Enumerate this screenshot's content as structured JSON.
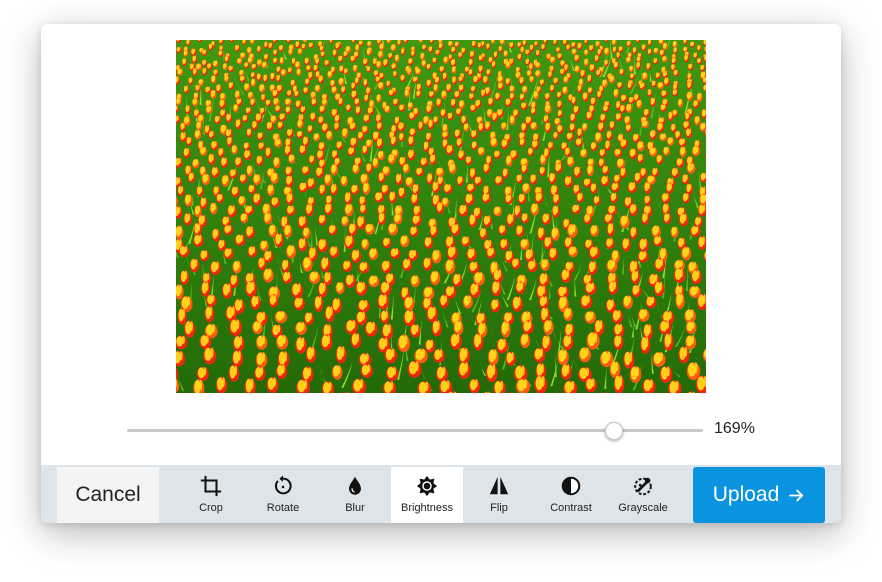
{
  "image": {
    "subject": "tulip-field-photo",
    "colors": {
      "background": "#2f7e0b",
      "petal_red": "#f3260c",
      "petal_yellow": "#ffe21a",
      "leaf": "#8edc2c"
    }
  },
  "zoom": {
    "value": 169,
    "min": 0,
    "max": 200,
    "label": "169%"
  },
  "toolbar": {
    "cancel_label": "Cancel",
    "upload_label": "Upload",
    "upload_icon": "arrow-right-icon",
    "tools": [
      {
        "id": "crop",
        "label": "Crop",
        "icon": "crop-icon",
        "active": false
      },
      {
        "id": "rotate",
        "label": "Rotate",
        "icon": "rotate-icon",
        "active": false
      },
      {
        "id": "blur",
        "label": "Blur",
        "icon": "droplet-icon",
        "active": false
      },
      {
        "id": "brightness",
        "label": "Brightness",
        "icon": "sun-icon",
        "active": true
      },
      {
        "id": "flip",
        "label": "Flip",
        "icon": "flip-icon",
        "active": false
      },
      {
        "id": "contrast",
        "label": "Contrast",
        "icon": "contrast-icon",
        "active": false
      },
      {
        "id": "grayscale",
        "label": "Grayscale",
        "icon": "grayscale-icon",
        "active": false
      }
    ]
  },
  "colors": {
    "accent": "#0a94e0",
    "toolbar_bg": "#dde5ea",
    "active_tool_bg": "#ffffff"
  }
}
